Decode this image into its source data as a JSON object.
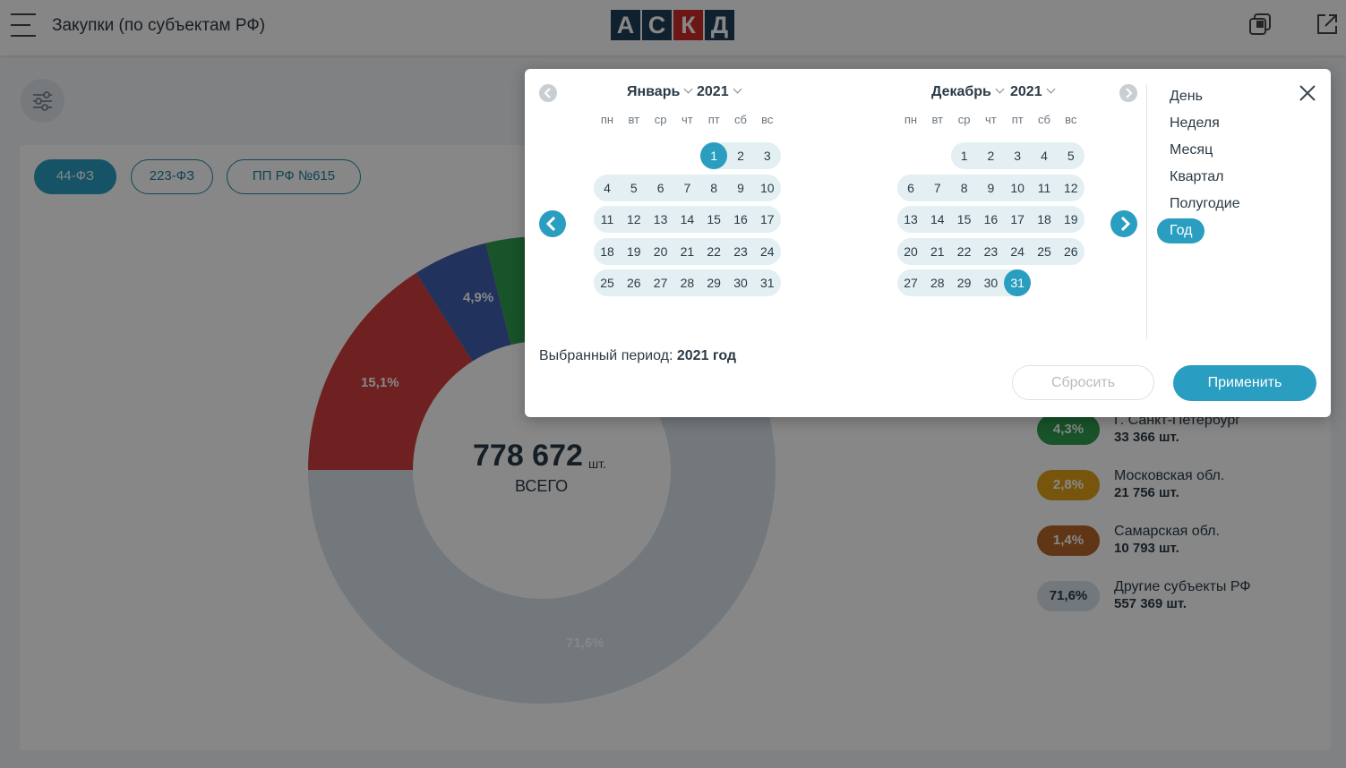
{
  "header": {
    "title": "Закупки (по субъектам РФ)",
    "logo": [
      "А",
      "С",
      "К",
      "Д"
    ]
  },
  "tabs": [
    "44-ФЗ",
    "223-ФЗ",
    "ПП РФ №615"
  ],
  "chart_data": {
    "type": "pie",
    "total_value": "778 672",
    "total_unit": "шт.",
    "total_label": "ВСЕГО",
    "slices": [
      {
        "label": "71,6%",
        "value": 71.6,
        "color": "#d8e2ea"
      },
      {
        "label": "15,1%",
        "value": 15.1,
        "color": "#d23d3d"
      },
      {
        "label": "4,9%",
        "value": 4.9,
        "color": "#3f5fb0"
      },
      {
        "label": "",
        "value": 3.0,
        "color": "#2f9e4f"
      }
    ]
  },
  "legend": [
    {
      "pct": "4,3%",
      "name": "Г. Санкт-Петербург",
      "count": "33 366 шт.",
      "color": "#2f9e4f"
    },
    {
      "pct": "2,8%",
      "name": "Московская обл.",
      "count": "21 756 шт.",
      "color": "#e0a11a"
    },
    {
      "pct": "1,4%",
      "name": "Самарская обл.",
      "count": "10 793 шт.",
      "color": "#b8672b"
    },
    {
      "pct": "71,6%",
      "name": "Другие субъекты РФ",
      "count": "557 369 шт.",
      "color": "#d8e2ea"
    }
  ],
  "calendar": {
    "left": {
      "month": "Январь",
      "year": "2021"
    },
    "right": {
      "month": "Декабрь",
      "year": "2021"
    },
    "weekdays": [
      "пн",
      "вт",
      "ср",
      "чт",
      "пт",
      "сб",
      "вс"
    ],
    "selected_start": "1",
    "selected_end": "31"
  },
  "periods": [
    "День",
    "Неделя",
    "Месяц",
    "Квартал",
    "Полугодие",
    "Год"
  ],
  "active_period": "Год",
  "selected_period": {
    "label": "Выбранный период:",
    "value": "2021 год"
  },
  "buttons": {
    "reset": "Сбросить",
    "apply": "Применить"
  }
}
